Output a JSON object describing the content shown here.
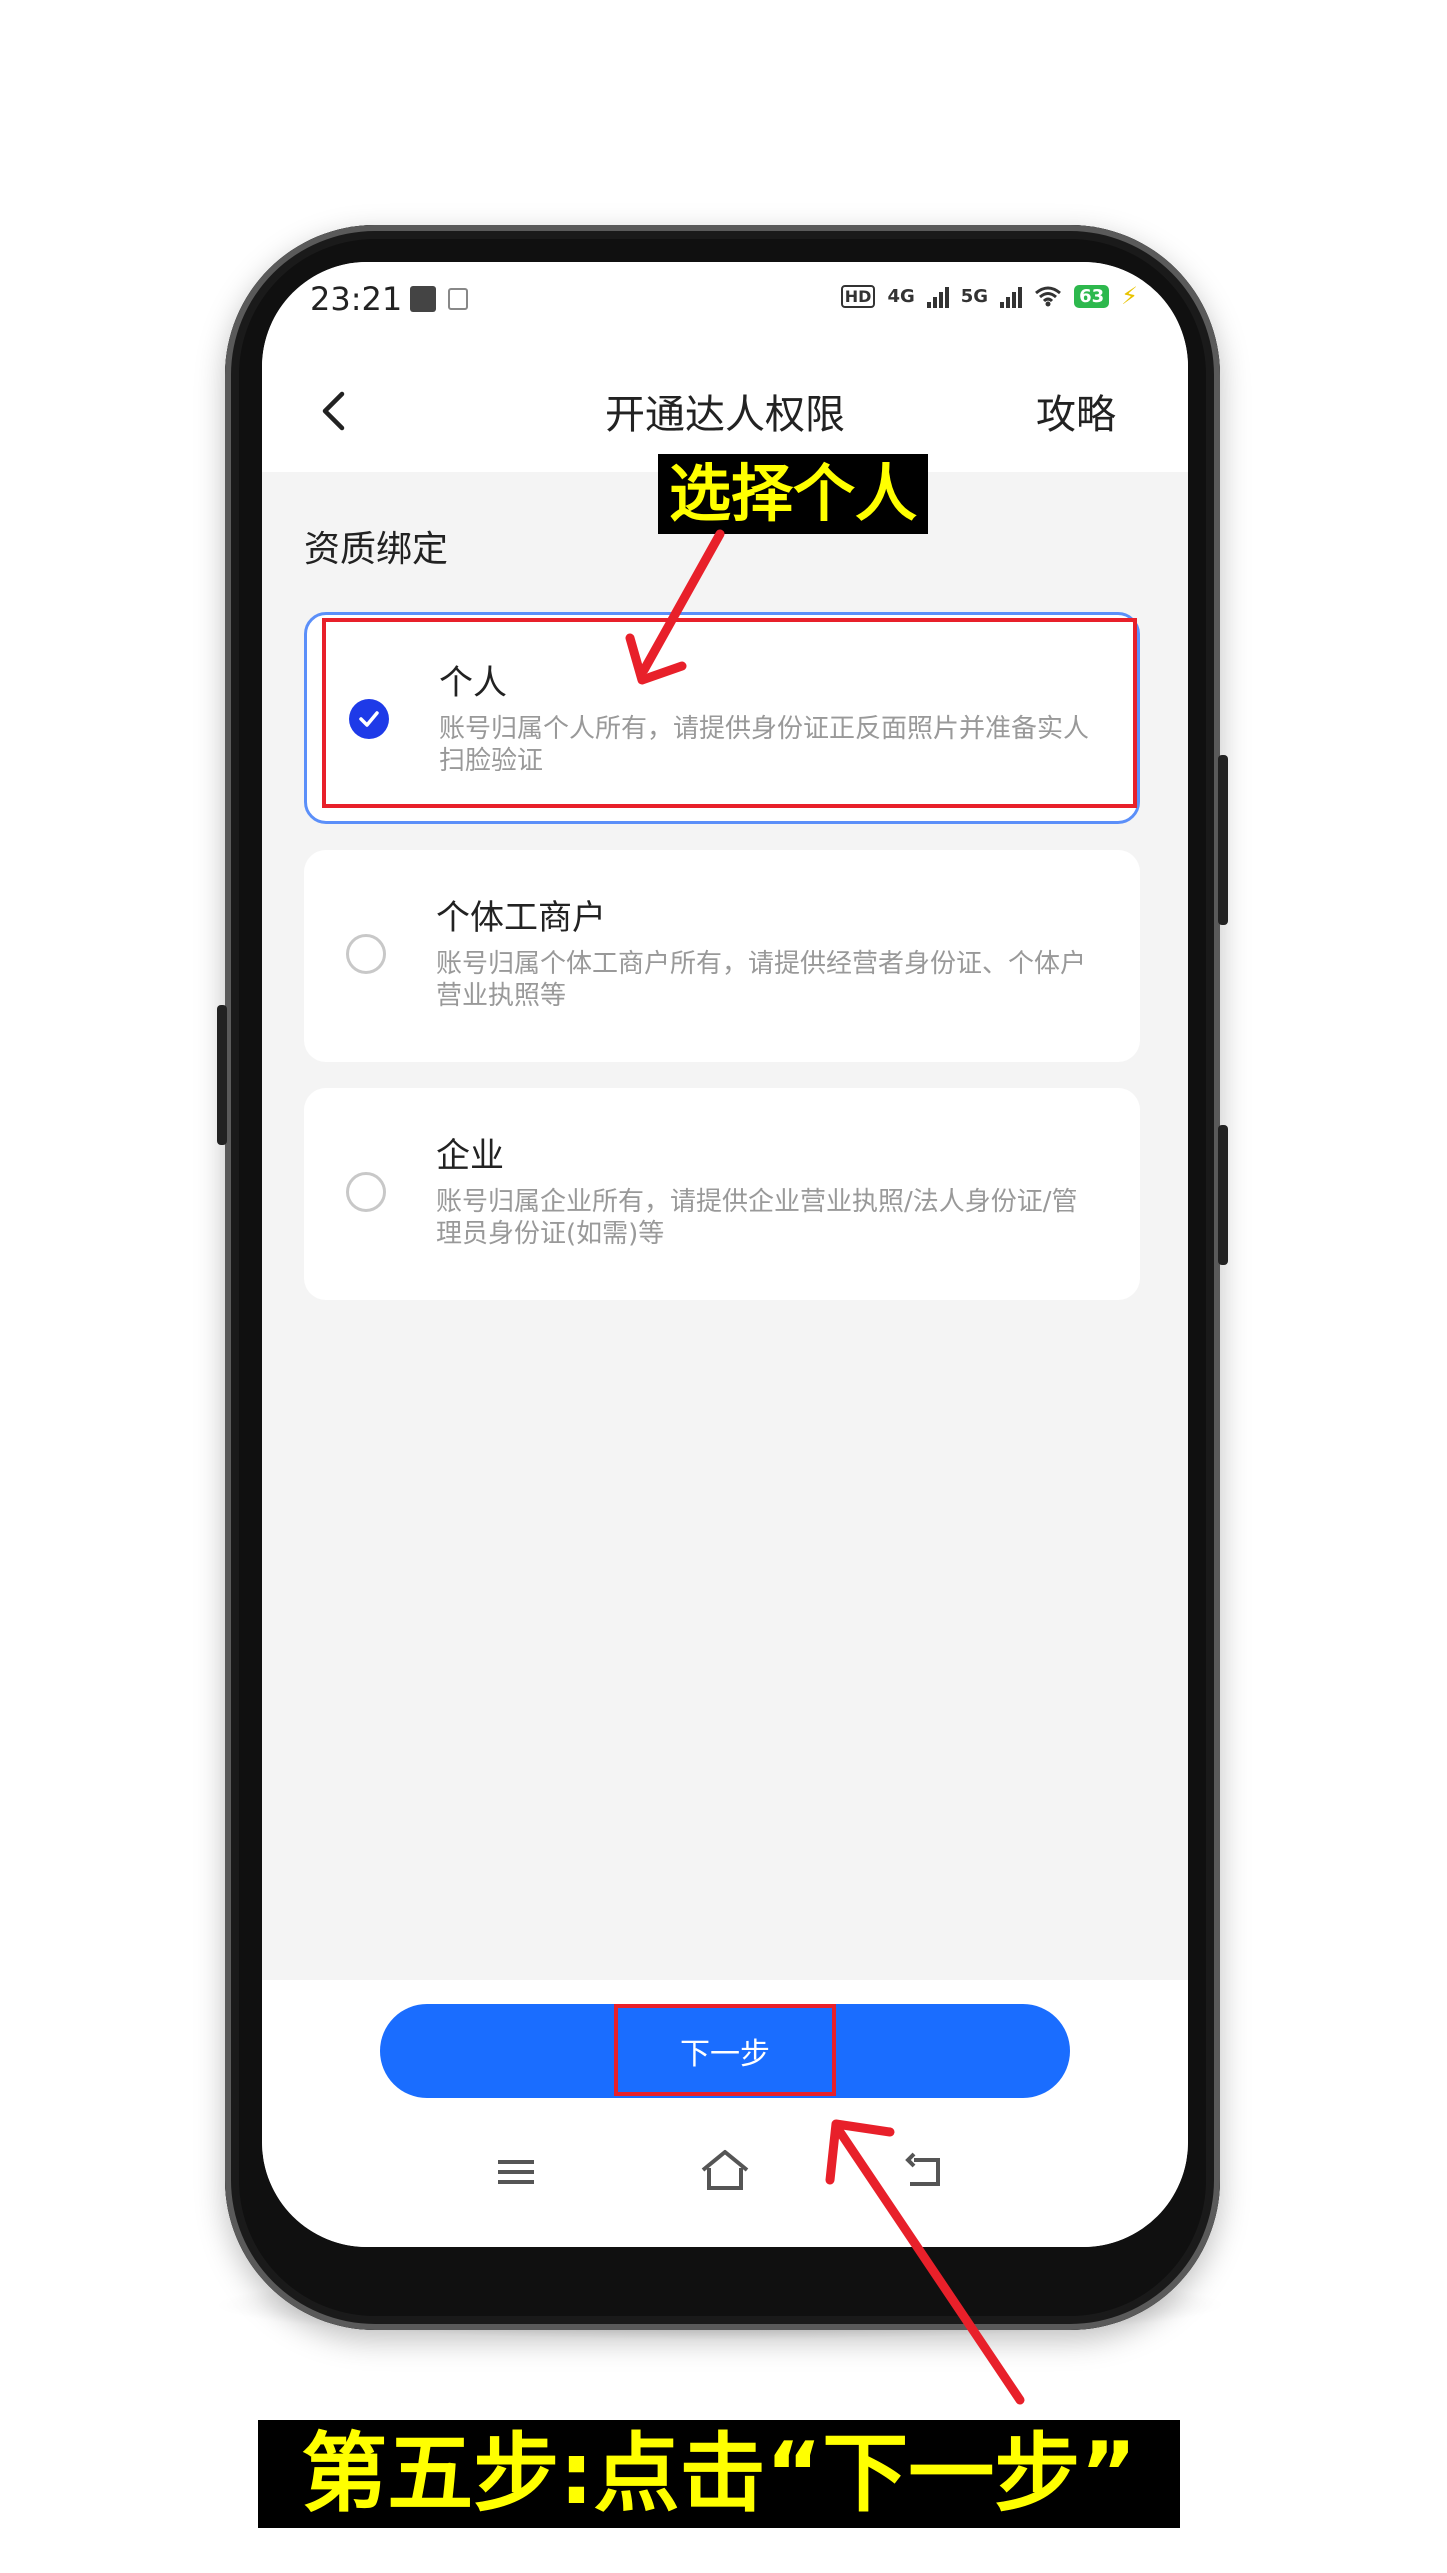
{
  "status_bar": {
    "time": "23:21",
    "hd_label": "HD",
    "network_4g": "4G",
    "network_5g": "5G",
    "battery": "63"
  },
  "header": {
    "title": "开通达人权限",
    "guide_label": "攻略"
  },
  "section": {
    "label": "资质绑定"
  },
  "options": [
    {
      "title": "个人",
      "desc": "账号归属个人所有，请提供身份证正反面照片并准备实人扫脸验证",
      "selected": true
    },
    {
      "title": "个体工商户",
      "desc": "账号归属个体工商户所有，请提供经营者身份证、个体户营业执照等",
      "selected": false
    },
    {
      "title": "企业",
      "desc": "账号归属企业所有，请提供企业营业执照/法人身份证/管理员身份证(如需)等",
      "selected": false
    }
  ],
  "next_button": {
    "label": "下一步"
  },
  "annotations": {
    "select_callout": "选择个人",
    "step_caption": "第五步:点击“下一步”",
    "highlight_color": "#e8202a",
    "callout_text_color": "#ffff00"
  },
  "colors": {
    "primary": "#1a6dff",
    "radio_selected": "#1e3ae8",
    "selected_border": "#5b8ff9"
  }
}
